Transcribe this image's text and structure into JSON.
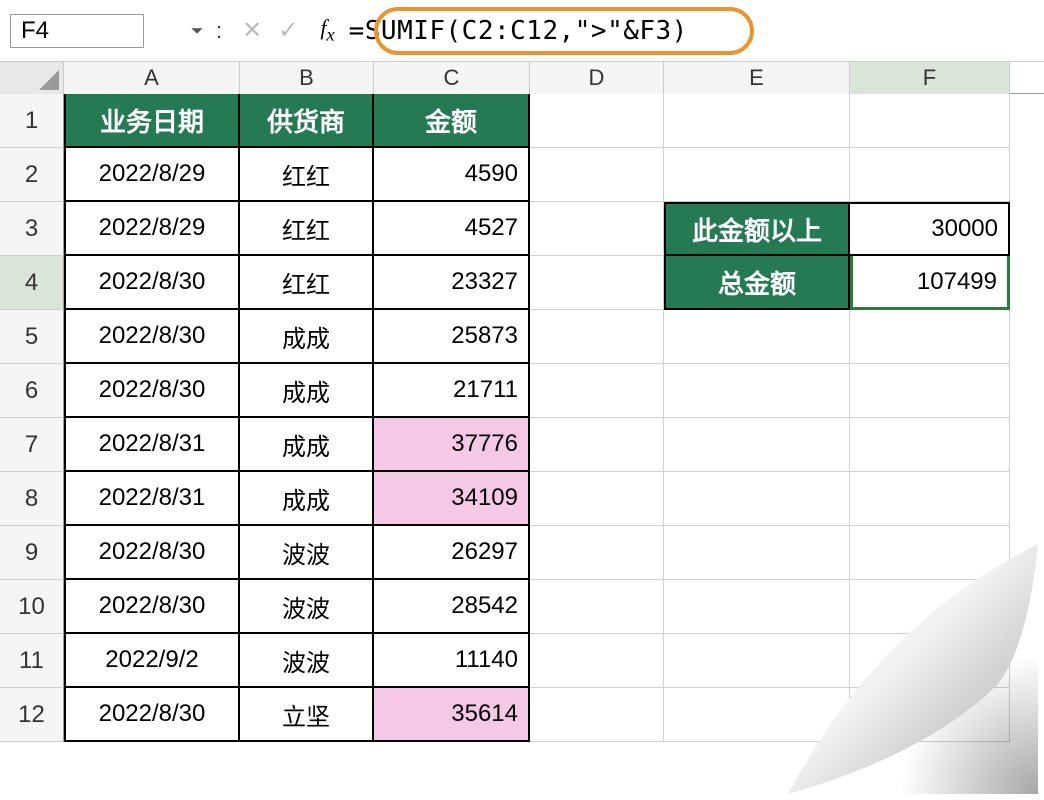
{
  "formula_bar": {
    "active_cell": "F4",
    "formula": "=SUMIF(C2:C12,\">\"&F3)"
  },
  "columns": [
    "A",
    "B",
    "C",
    "D",
    "E",
    "F"
  ],
  "row_numbers": [
    "1",
    "2",
    "3",
    "4",
    "5",
    "6",
    "7",
    "8",
    "9",
    "10",
    "11",
    "12"
  ],
  "table": {
    "headers": {
      "date": "业务日期",
      "supplier": "供货商",
      "amount": "金额"
    },
    "rows": [
      {
        "date": "2022/8/29",
        "supplier": "红红",
        "amount": "4590",
        "hl": false
      },
      {
        "date": "2022/8/29",
        "supplier": "红红",
        "amount": "4527",
        "hl": false
      },
      {
        "date": "2022/8/30",
        "supplier": "红红",
        "amount": "23327",
        "hl": false
      },
      {
        "date": "2022/8/30",
        "supplier": "成成",
        "amount": "25873",
        "hl": false
      },
      {
        "date": "2022/8/30",
        "supplier": "成成",
        "amount": "21711",
        "hl": false
      },
      {
        "date": "2022/8/31",
        "supplier": "成成",
        "amount": "37776",
        "hl": true
      },
      {
        "date": "2022/8/31",
        "supplier": "成成",
        "amount": "34109",
        "hl": true
      },
      {
        "date": "2022/8/30",
        "supplier": "波波",
        "amount": "26297",
        "hl": false
      },
      {
        "date": "2022/8/30",
        "supplier": "波波",
        "amount": "28542",
        "hl": false
      },
      {
        "date": "2022/9/2",
        "supplier": "波波",
        "amount": "11140",
        "hl": false
      },
      {
        "date": "2022/8/30",
        "supplier": "立坚",
        "amount": "35614",
        "hl": true
      }
    ]
  },
  "summary": {
    "threshold_label": "此金额以上",
    "threshold_value": "30000",
    "total_label": "总金额",
    "total_value": "107499"
  },
  "colors": {
    "header_green": "#257a53",
    "highlight_pink": "#f5c9e6",
    "accent_orange": "#e89530"
  }
}
